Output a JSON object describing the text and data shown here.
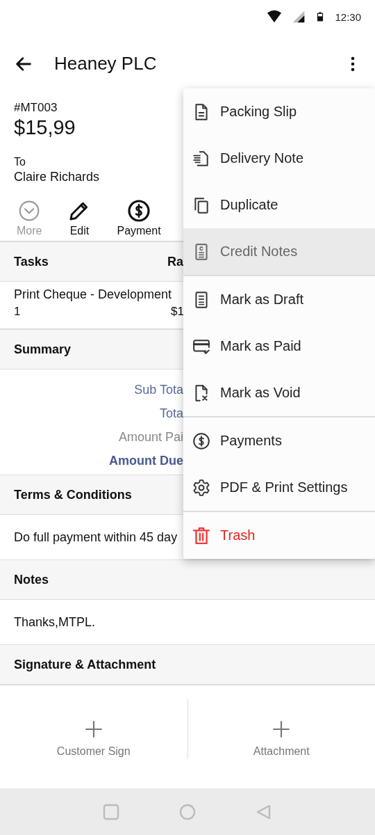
{
  "status_bar": {
    "time": "12:30"
  },
  "app_bar": {
    "title": "Heaney PLC"
  },
  "invoice": {
    "number": "#MT003",
    "amount": "$15,99",
    "to_label": "To",
    "customer": "Claire Richards"
  },
  "actions": [
    {
      "kind": "more",
      "label": "More",
      "disabled": true
    },
    {
      "kind": "edit",
      "label": "Edit",
      "disabled": false
    },
    {
      "kind": "payment",
      "label": "Payment",
      "disabled": false
    }
  ],
  "tasks": {
    "title": "Tasks",
    "column_2": "Ra",
    "rows": [
      {
        "name": "Print Cheque - Development",
        "qty": "1",
        "column_2": "$1"
      }
    ]
  },
  "summary": {
    "title": "Summary",
    "rows": [
      {
        "kind": "link",
        "label": "Sub Tota"
      },
      {
        "kind": "link",
        "label": "Tota"
      },
      {
        "kind": "muted",
        "label": "Amount Pai"
      },
      {
        "kind": "strong",
        "label": "Amount Due"
      }
    ]
  },
  "terms": {
    "title": "Terms & Conditions",
    "text": "Do full payment within 45 day"
  },
  "notes": {
    "title": "Notes",
    "text": "Thanks,MTPL."
  },
  "signature": {
    "title": "Signature & Attachment",
    "buttons": [
      "Customer Sign",
      "Attachment"
    ]
  },
  "menu": {
    "groups": [
      [
        {
          "label": "Packing Slip",
          "selected": false
        },
        {
          "label": "Delivery Note",
          "selected": false
        },
        {
          "label": "Duplicate",
          "selected": false
        },
        {
          "label": "Credit Notes",
          "selected": true
        }
      ],
      [
        {
          "label": "Mark as Draft",
          "selected": false
        },
        {
          "label": "Mark as Paid",
          "selected": false
        },
        {
          "label": "Mark as Void",
          "selected": false
        }
      ],
      [
        {
          "label": "Payments",
          "selected": false
        },
        {
          "label": "PDF & Print Settings",
          "selected": false
        }
      ],
      [
        {
          "label": "Trash",
          "selected": false,
          "kind": "danger"
        }
      ]
    ]
  }
}
